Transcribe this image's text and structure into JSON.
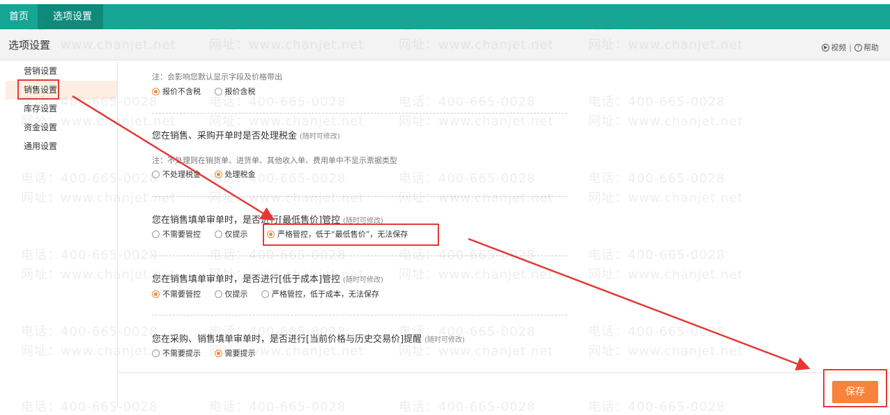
{
  "tabs": {
    "home": "首页",
    "active": "选项设置",
    "close": "×"
  },
  "header": {
    "title": "选项设置",
    "video": "视频",
    "help": "帮助",
    "sep": "|"
  },
  "sidebar": {
    "items": [
      {
        "label": "营销设置"
      },
      {
        "label": "销售设置"
      },
      {
        "label": "库存设置"
      },
      {
        "label": "资金设置"
      },
      {
        "label": "通用设置"
      }
    ],
    "active_index": 1
  },
  "sections": {
    "s1": {
      "note": "注：会影响您默认显示字段及价格带出",
      "options": [
        "报价不含税",
        "报价含税"
      ],
      "selected": 0
    },
    "s2": {
      "question": "您在销售、采购开单时是否处理税金",
      "hint": "(随时可修改)",
      "note": "注：不处理则在销货单、进货单、其他收入单、费用单中不显示票据类型",
      "options": [
        "不处理税金",
        "处理税金"
      ],
      "selected": 1
    },
    "s3": {
      "question": "您在销售填单审单时，是否进行[最低售价]管控",
      "hint": "(随时可修改)",
      "options": [
        "不需要管控",
        "仅提示",
        "严格管控，低于“最低售价”，无法保存"
      ],
      "selected": 2
    },
    "s4": {
      "question": "您在销售填单审单时，是否进行[低于成本]管控",
      "hint": "(随时可修改)",
      "options": [
        "不需要管控",
        "仅提示",
        "严格管控，低于成本，无法保存"
      ],
      "selected": 0
    },
    "s5": {
      "question": "您在采购、销售填单审单时，是否进行[当前价格与历史交易价]提醒",
      "hint": "(随时可修改)",
      "options": [
        "不需要提示",
        "需要提示"
      ],
      "selected": 1
    }
  },
  "footer": {
    "save_label": "保存"
  },
  "watermark": {
    "phone": "电话：400-665-0028",
    "site": "网址：www.chanjet.net"
  },
  "colors": {
    "accent": "#16a594",
    "accent_dark": "#0e8a7b",
    "orange": "#f7833d",
    "annotation_red": "#e53935"
  }
}
